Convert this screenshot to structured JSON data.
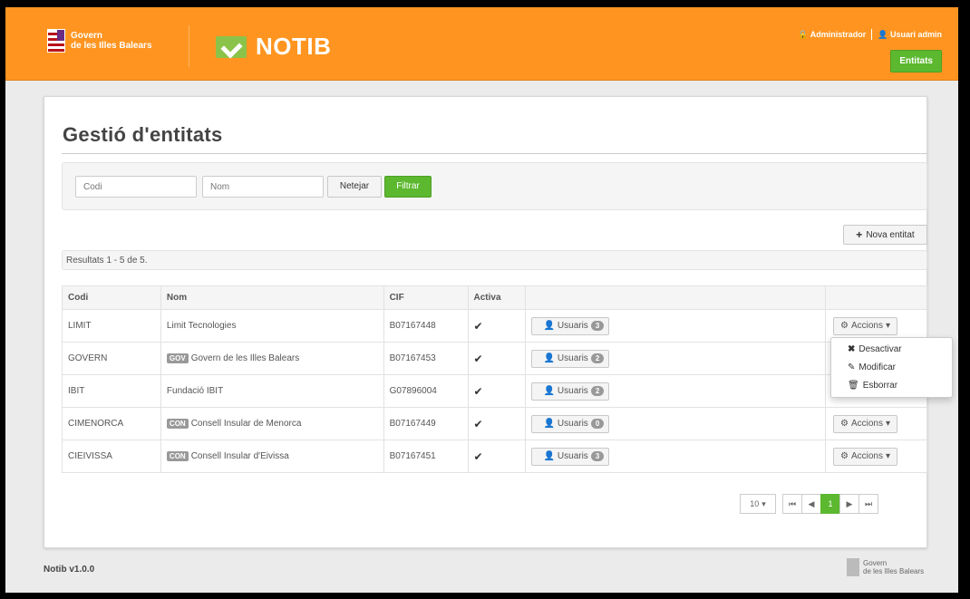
{
  "header": {
    "gov_line1": "Govern",
    "gov_line2": "de les Illes Balears",
    "app_name": "NOTIB",
    "role": "Administrador",
    "user": "Usuari admin",
    "nav_button": "Entitats"
  },
  "page": {
    "title": "Gestió d'entitats"
  },
  "filters": {
    "codi_placeholder": "Codi",
    "nom_placeholder": "Nom",
    "clear_label": "Netejar",
    "filter_label": "Filtrar"
  },
  "new_button": "Nova entitat",
  "results_text": "Resultats 1 - 5 de 5.",
  "table": {
    "headers": [
      "Codi",
      "Nom",
      "CIF",
      "Activa"
    ],
    "users_label": "Usuaris",
    "actions_label": "Accions",
    "rows": [
      {
        "codi": "LIMIT",
        "tag": "",
        "nom": "Limit Tecnologies",
        "cif": "B07167448",
        "users": "3"
      },
      {
        "codi": "GOVERN",
        "tag": "GOV",
        "nom": "Govern de les Illes Balears",
        "cif": "B07167453",
        "users": "2"
      },
      {
        "codi": "IBIT",
        "tag": "",
        "nom": "Fundació IBIT",
        "cif": "G07896004",
        "users": "2"
      },
      {
        "codi": "CIMENORCA",
        "tag": "CON",
        "nom": "Consell Insular de Menorca",
        "cif": "B07167449",
        "users": "0"
      },
      {
        "codi": "CIEIVISSA",
        "tag": "CON",
        "nom": "Consell Insular d'Eivissa",
        "cif": "B07167451",
        "users": "3"
      }
    ]
  },
  "dropdown": {
    "items": [
      "Desactivar",
      "Modificar",
      "Esborrar"
    ]
  },
  "pagination": {
    "page_size": "10",
    "current_page": "1"
  },
  "footer": {
    "version": "Notib v1.0.0",
    "gov_line1": "Govern",
    "gov_line2": "de les Illes Balears"
  },
  "colors": {
    "brand_orange": "#ff9520",
    "accent_green": "#5cb82f"
  }
}
